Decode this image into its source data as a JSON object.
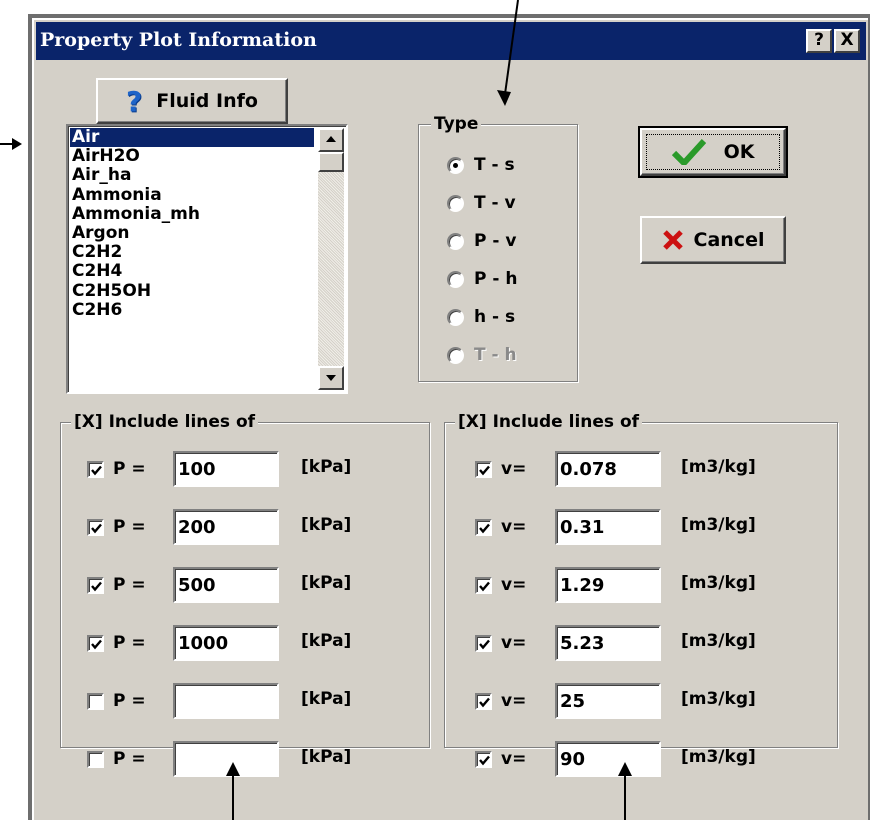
{
  "dialog": {
    "title": "Property Plot Information",
    "help_button": "?",
    "close_button": "X"
  },
  "fluid_info_button": "Fluid Info",
  "fluid_list": {
    "items": [
      "Air",
      "AirH2O",
      "Air_ha",
      "Ammonia",
      "Ammonia_mh",
      "Argon",
      "C2H2",
      "C2H4",
      "C2H5OH",
      "C2H6"
    ],
    "selected": "Air"
  },
  "type_group": {
    "label": "Type",
    "options": [
      {
        "label": "T - s",
        "selected": true,
        "enabled": true
      },
      {
        "label": "T - v",
        "selected": false,
        "enabled": true
      },
      {
        "label": "P - v",
        "selected": false,
        "enabled": true
      },
      {
        "label": "P - h",
        "selected": false,
        "enabled": true
      },
      {
        "label": "h - s",
        "selected": false,
        "enabled": true
      },
      {
        "label": "T - h",
        "selected": false,
        "enabled": false
      }
    ]
  },
  "buttons": {
    "ok": "OK",
    "cancel": "Cancel"
  },
  "pressure_group": {
    "label": "[X] Include lines of",
    "var": "P =",
    "unit": "[kPa]",
    "rows": [
      {
        "checked": true,
        "value": "100"
      },
      {
        "checked": true,
        "value": "200"
      },
      {
        "checked": true,
        "value": "500"
      },
      {
        "checked": true,
        "value": "1000"
      },
      {
        "checked": false,
        "value": ""
      },
      {
        "checked": false,
        "value": ""
      }
    ]
  },
  "volume_group": {
    "label": "[X] Include lines of",
    "var": "v=",
    "unit": "[m3/kg]",
    "rows": [
      {
        "checked": true,
        "value": "0.078"
      },
      {
        "checked": true,
        "value": "0.31"
      },
      {
        "checked": true,
        "value": "1.29"
      },
      {
        "checked": true,
        "value": "5.23"
      },
      {
        "checked": true,
        "value": "25"
      },
      {
        "checked": true,
        "value": "90"
      }
    ]
  },
  "colors": {
    "titlebar": "#0a246a",
    "face": "#d4d0c8",
    "ok_check": "#2a9a2a",
    "cancel_x": "#cc1111",
    "help_icon": "#1e64c8"
  }
}
